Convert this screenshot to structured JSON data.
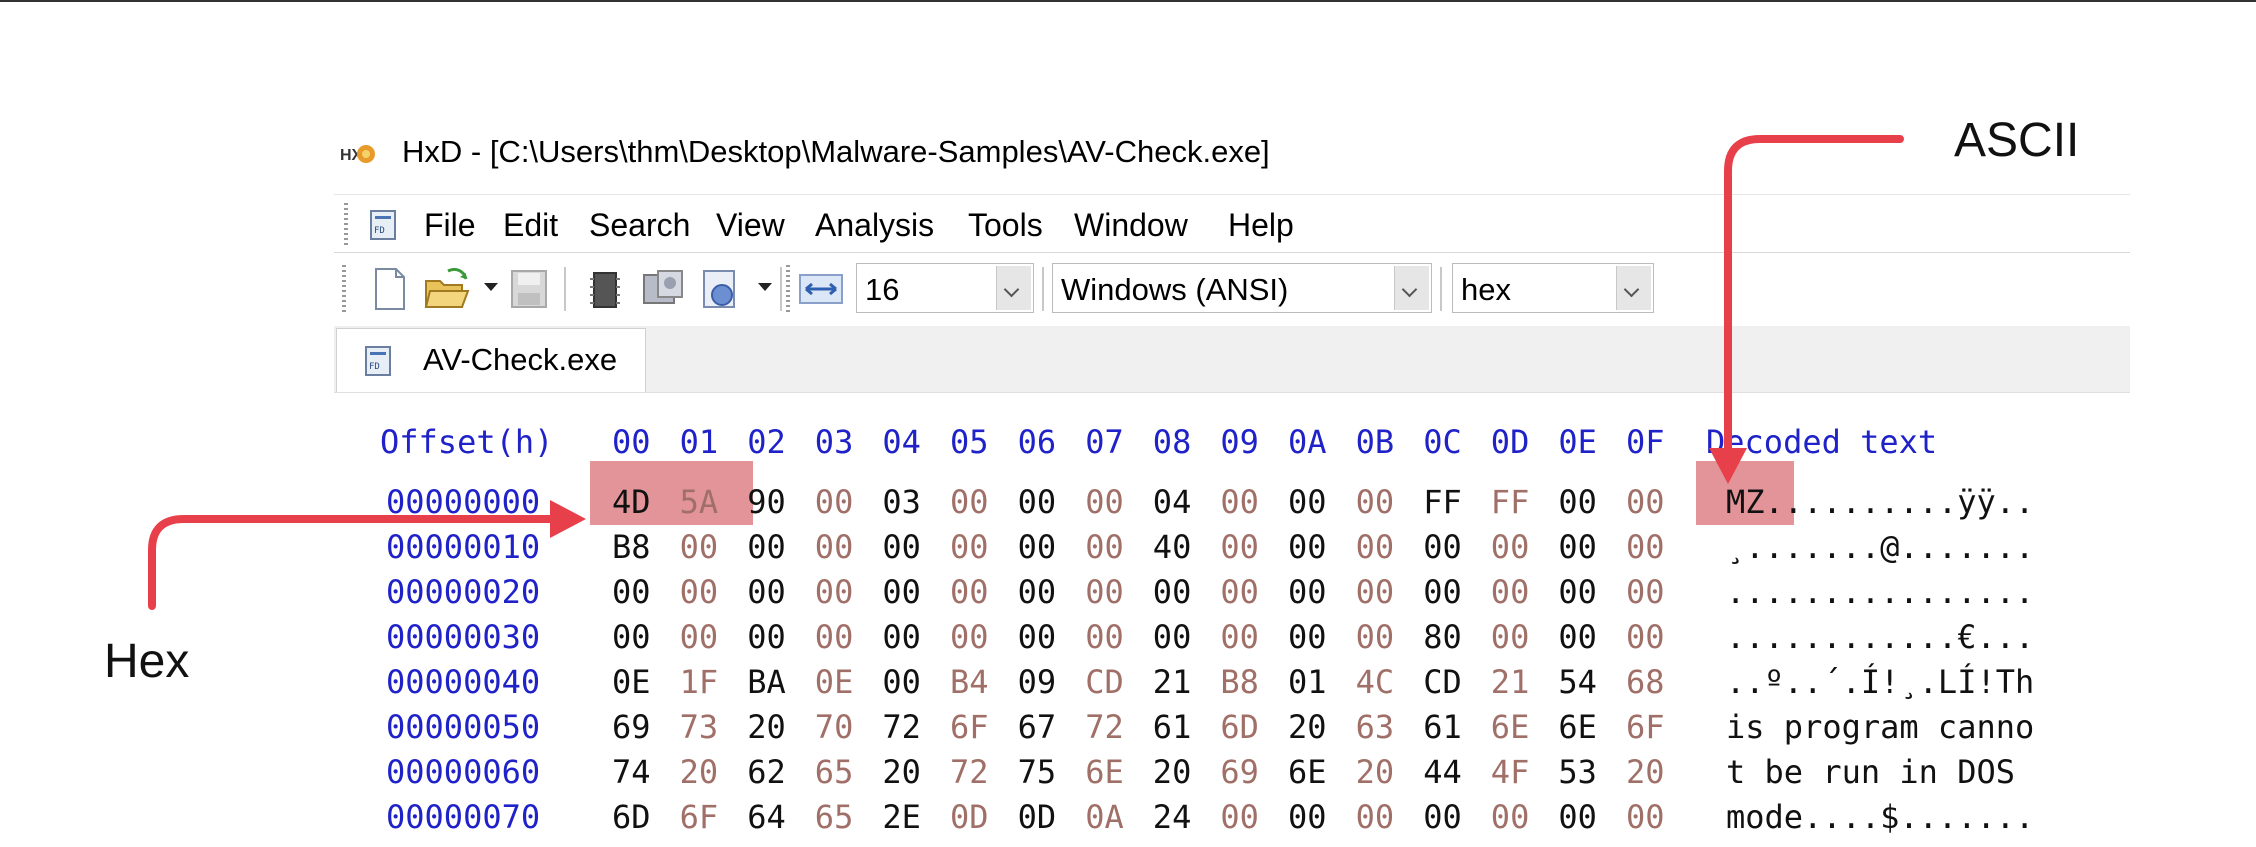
{
  "window": {
    "title": "HxD - [C:\\Users\\thm\\Desktop\\Malware-Samples\\AV-Check.exe]"
  },
  "menu": [
    "File",
    "Edit",
    "Search",
    "View",
    "Analysis",
    "Tools",
    "Window",
    "Help"
  ],
  "toolbar": {
    "buttons": [
      "new-file-icon",
      "open-file-icon",
      "save-icon",
      "memory-chip-icon",
      "disk-icon",
      "process-ram-icon",
      "bytes-per-row-icon"
    ],
    "bytes_per_row": "16",
    "charset": "Windows (ANSI)",
    "offset_base": "hex"
  },
  "tab": {
    "label": "AV-Check.exe"
  },
  "hex": {
    "header_offset": "Offset(h)",
    "columns": [
      "00",
      "01",
      "02",
      "03",
      "04",
      "05",
      "06",
      "07",
      "08",
      "09",
      "0A",
      "0B",
      "0C",
      "0D",
      "0E",
      "0F"
    ],
    "header_decoded": "Decoded text",
    "rows": [
      {
        "offset": "00000000",
        "bytes": [
          "4D",
          "5A",
          "90",
          "00",
          "03",
          "00",
          "00",
          "00",
          "04",
          "00",
          "00",
          "00",
          "FF",
          "FF",
          "00",
          "00"
        ],
        "decoded": "MZ..........ÿÿ.."
      },
      {
        "offset": "00000010",
        "bytes": [
          "B8",
          "00",
          "00",
          "00",
          "00",
          "00",
          "00",
          "00",
          "40",
          "00",
          "00",
          "00",
          "00",
          "00",
          "00",
          "00"
        ],
        "decoded": "¸.......@......."
      },
      {
        "offset": "00000020",
        "bytes": [
          "00",
          "00",
          "00",
          "00",
          "00",
          "00",
          "00",
          "00",
          "00",
          "00",
          "00",
          "00",
          "00",
          "00",
          "00",
          "00"
        ],
        "decoded": "................"
      },
      {
        "offset": "00000030",
        "bytes": [
          "00",
          "00",
          "00",
          "00",
          "00",
          "00",
          "00",
          "00",
          "00",
          "00",
          "00",
          "00",
          "80",
          "00",
          "00",
          "00"
        ],
        "decoded": "............€..."
      },
      {
        "offset": "00000040",
        "bytes": [
          "0E",
          "1F",
          "BA",
          "0E",
          "00",
          "B4",
          "09",
          "CD",
          "21",
          "B8",
          "01",
          "4C",
          "CD",
          "21",
          "54",
          "68"
        ],
        "decoded": "..º..´.Í!¸.LÍ!Th"
      },
      {
        "offset": "00000050",
        "bytes": [
          "69",
          "73",
          "20",
          "70",
          "72",
          "6F",
          "67",
          "72",
          "61",
          "6D",
          "20",
          "63",
          "61",
          "6E",
          "6E",
          "6F"
        ],
        "decoded": "is program canno"
      },
      {
        "offset": "00000060",
        "bytes": [
          "74",
          "20",
          "62",
          "65",
          "20",
          "72",
          "75",
          "6E",
          "20",
          "69",
          "6E",
          "20",
          "44",
          "4F",
          "53",
          "20"
        ],
        "decoded": "t be run in DOS "
      },
      {
        "offset": "00000070",
        "bytes": [
          "6D",
          "6F",
          "64",
          "65",
          "2E",
          "0D",
          "0D",
          "0A",
          "24",
          "00",
          "00",
          "00",
          "00",
          "00",
          "00",
          "00"
        ],
        "decoded": "mode....$......."
      }
    ]
  },
  "annotations": {
    "hex_label": "Hex",
    "ascii_label": "ASCII"
  },
  "colors": {
    "offset_blue": "#1f22c8",
    "highlight": "#cd4650",
    "arrow": "#e8404a"
  }
}
